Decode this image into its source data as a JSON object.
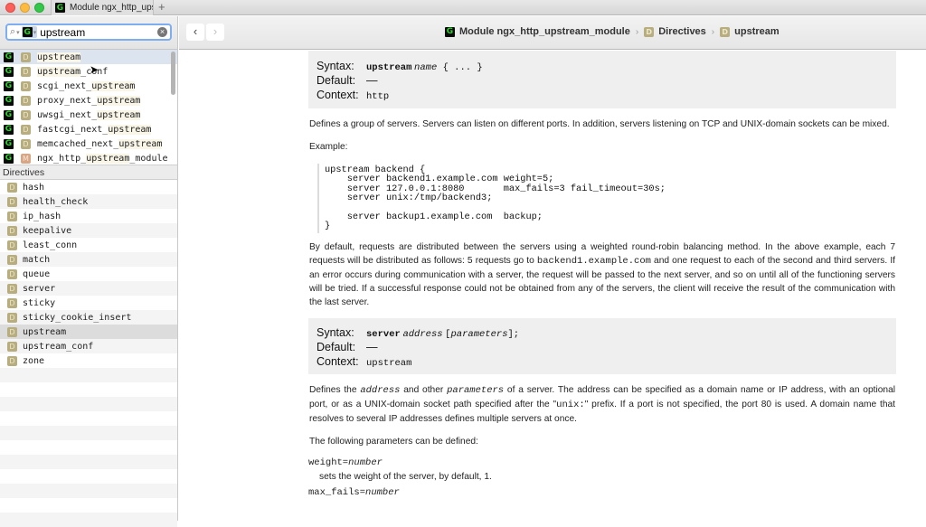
{
  "window": {
    "tab_title": "Module ngx_http_upstream_module",
    "new_tab_label": "+"
  },
  "search": {
    "value": "upstream",
    "scope_icon": "G",
    "clear_label": "×"
  },
  "results": [
    {
      "icon": "D",
      "pre": "",
      "hl": "upstream",
      "post": ""
    },
    {
      "icon": "D",
      "pre": "",
      "hl": "upstream",
      "post": "_conf"
    },
    {
      "icon": "D",
      "pre": "scgi_next_",
      "hl": "upstream",
      "post": ""
    },
    {
      "icon": "D",
      "pre": "proxy_next_",
      "hl": "upstream",
      "post": ""
    },
    {
      "icon": "D",
      "pre": "uwsgi_next_",
      "hl": "upstream",
      "post": ""
    },
    {
      "icon": "D",
      "pre": "fastcgi_next_",
      "hl": "upstream",
      "post": ""
    },
    {
      "icon": "D",
      "pre": "memcached_next_",
      "hl": "upstream",
      "post": ""
    },
    {
      "icon": "M",
      "pre": "ngx_http_",
      "hl": "upstream",
      "post": "_module"
    }
  ],
  "directives": {
    "header": "Directives",
    "items": [
      "hash",
      "health_check",
      "ip_hash",
      "keepalive",
      "least_conn",
      "match",
      "queue",
      "server",
      "sticky",
      "sticky_cookie_insert",
      "upstream",
      "upstream_conf",
      "zone"
    ],
    "selected": "upstream"
  },
  "toolbar": {
    "back": "‹",
    "forward": "›",
    "breadcrumb": [
      "Module ngx_http_upstream_module",
      "Directives",
      "upstream"
    ],
    "separator": "›"
  },
  "doc": {
    "labels": {
      "syntax": "Syntax:",
      "default": "Default:",
      "context": "Context:"
    },
    "upstream": {
      "syntax_keyword": "upstream",
      "syntax_arg": "name",
      "syntax_rest": " { ... }",
      "default": "—",
      "context": "http",
      "desc": "Defines a group of servers. Servers can listen on different ports. In addition, servers listening on TCP and UNIX-domain sockets can be mixed.",
      "example_label": "Example:",
      "example_code": "upstream backend {\n    server backend1.example.com weight=5;\n    server 127.0.0.1:8080       max_fails=3 fail_timeout=30s;\n    server unix:/tmp/backend3;\n\n    server backup1.example.com  backup;\n}",
      "p2_a": "By default, requests are distributed between the servers using a weighted round-robin balancing method. In the above example, each 7 requests will be distributed as follows: 5 requests go to ",
      "p2_code": "backend1.example.com",
      "p2_b": " and one request to each of the second and third servers. If an error occurs during communication with a server, the request will be passed to the next server, and so on until all of the functioning servers will be tried. If a successful response could not be obtained from any of the servers, the client will receive the result of the communication with the last server."
    },
    "server": {
      "syntax_keyword": "server",
      "syntax_arg1": "address",
      "syntax_arg2": "parameters",
      "default": "—",
      "context": "upstream",
      "d_a": "Defines the ",
      "d_address": "address",
      "d_b": " and other ",
      "d_parameters": "parameters",
      "d_c": " of a server. The address can be specified as a domain name or IP address, with an optional port, or as a UNIX-domain socket path specified after the \"",
      "d_unix": "unix:",
      "d_d": "\" prefix. If a port is not specified, the port 80 is used. A domain name that resolves to several IP addresses defines multiple servers at once.",
      "params_intro": "The following parameters can be defined:",
      "params": [
        {
          "name": "weight=",
          "arg": "number",
          "desc": "sets the weight of the server, by default, 1."
        },
        {
          "name": "max_fails=",
          "arg": "number",
          "desc": ""
        }
      ]
    }
  }
}
